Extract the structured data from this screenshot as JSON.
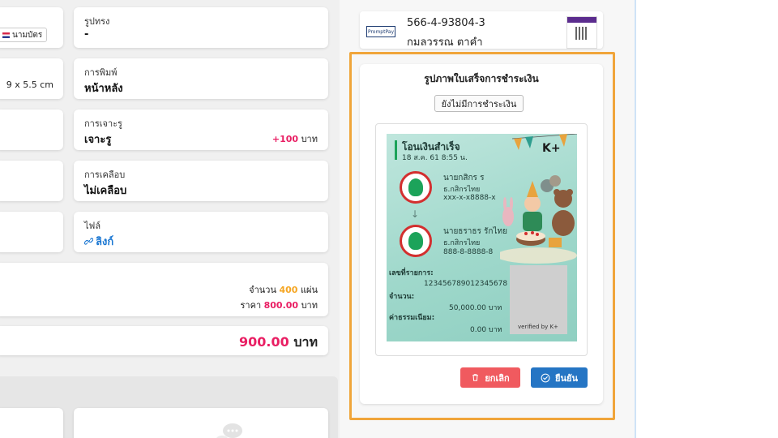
{
  "left_grid": {
    "rows": [
      {
        "left": {
          "tag": "นามบัตร"
        },
        "right": {
          "label": "รูปทรง",
          "value": "-"
        }
      },
      {
        "left": {
          "value": "9 x 5.5 cm"
        },
        "right": {
          "label": "การพิมพ์",
          "value": "หน้าหลัง"
        }
      },
      {
        "left": {},
        "right": {
          "label": "การเจาะรู",
          "value": "เจาะรู",
          "extra_price": "+100",
          "extra_unit": "บาท"
        }
      },
      {
        "left": {},
        "right": {
          "label": "การเคลือบ",
          "value": "ไม่เคลือบ"
        }
      },
      {
        "left": {},
        "right": {
          "label": "ไฟล์",
          "link": "ลิงก์"
        }
      }
    ]
  },
  "summary": {
    "quantity_label": "จำนวน",
    "quantity_value": "400",
    "quantity_unit": "แผ่น",
    "price_label": "ราคา",
    "price_value": "800.00",
    "price_unit": "บาท"
  },
  "total": {
    "value": "900.00",
    "unit": "บาท"
  },
  "payment_account": {
    "account_number": "566-4-93804-3",
    "account_name": "กมลวรรณ ตาคำ",
    "logo_text": "PromptPay"
  },
  "payment_slip_card": {
    "title": "รูปภาพใบเสร็จการชำระเงิน",
    "status_button": "ยังไม่มีการชำระเงิน",
    "slip": {
      "heading": "โอนเงินสำเร็จ",
      "datetime": "18 ส.ค. 61  8:55 น.",
      "sender_name": "นายกสิกร ร",
      "sender_bank": "ธ.กสิกรไทย",
      "sender_account": "xxx-x-x8888-x",
      "receiver_name": "นายธราธร รักไทย",
      "receiver_bank": "ธ.กสิกรไทย",
      "receiver_account": "888-8-8888-8",
      "ref_label": "เลขที่รายการ:",
      "ref_value": "123456789012345678",
      "amount_label": "จำนวน:",
      "amount_value": "50,000.00 บาท",
      "fee_label": "ค่าธรรมเนียม:",
      "fee_value": "0.00 บาท",
      "verified": "verified by K+",
      "brand": "K+"
    },
    "cancel_button": "ยกเลิก",
    "confirm_button": "ยืนยัน"
  },
  "colors": {
    "accent_pink": "#e91e63",
    "accent_orange": "#f5a623",
    "link_blue": "#1976d2",
    "highlight_frame": "#f0a53a",
    "cancel_red": "#f05a5f",
    "confirm_blue": "#2575c4"
  },
  "icons": [
    "link-icon",
    "trash-icon",
    "check-circle-icon",
    "qr-code-icon",
    "chat-bubble-icon"
  ]
}
